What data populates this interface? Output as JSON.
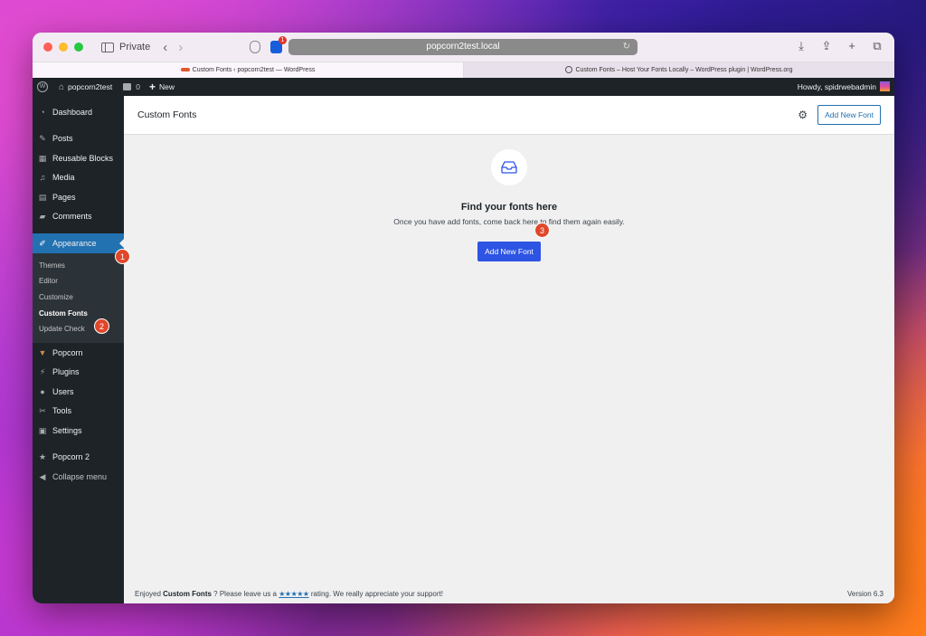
{
  "browser": {
    "private_label": "Private",
    "url": "popcorn2test.local",
    "tabs": [
      {
        "label": "Custom Fonts ‹ popcorn2test — WordPress"
      },
      {
        "label": "Custom Fonts – Host Your Fonts Locally – WordPress plugin | WordPress.org"
      }
    ],
    "extension_badge": "1"
  },
  "adminbar": {
    "site_name": "popcorn2test",
    "comment_count": "0",
    "new_label": "New",
    "howdy": "Howdy, spidrwebadmin"
  },
  "sidebar": {
    "items_top": [
      {
        "label": "Dashboard",
        "icon": "dashboard-icon"
      },
      {
        "label": "Posts",
        "icon": "pin-icon"
      },
      {
        "label": "Reusable Blocks",
        "icon": "blocks-icon"
      },
      {
        "label": "Media",
        "icon": "media-icon"
      },
      {
        "label": "Pages",
        "icon": "pages-icon"
      },
      {
        "label": "Comments",
        "icon": "comment-icon"
      }
    ],
    "appearance": {
      "label": "Appearance",
      "icon": "brush-icon"
    },
    "submenu": [
      {
        "label": "Themes"
      },
      {
        "label": "Editor"
      },
      {
        "label": "Customize"
      },
      {
        "label": "Custom Fonts"
      },
      {
        "label": "Update Check"
      }
    ],
    "items_bottom": [
      {
        "label": "Popcorn",
        "icon": "popcorn-icon"
      },
      {
        "label": "Plugins",
        "icon": "plug-icon"
      },
      {
        "label": "Users",
        "icon": "user-icon"
      },
      {
        "label": "Tools",
        "icon": "wrench-icon"
      },
      {
        "label": "Settings",
        "icon": "settings-icon"
      },
      {
        "label": "Popcorn 2",
        "icon": "star-icon"
      },
      {
        "label": "Collapse menu",
        "icon": "collapse-icon"
      }
    ],
    "badges": [
      "1",
      "2",
      "3"
    ]
  },
  "main": {
    "page_title": "Custom Fonts",
    "header_button": "Add New Font",
    "empty_title": "Find your fonts here",
    "empty_desc": "Once you have add fonts, come back here to find them again easily.",
    "primary_button": "Add New Font"
  },
  "footer": {
    "text_before": "Enjoyed",
    "plugin_name": "Custom Fonts",
    "text_middle": "? Please leave us a",
    "stars": "★★★★★",
    "text_after": "rating. We really appreciate your support!",
    "version": "Version 6.3"
  },
  "colors": {
    "wp_admin_dark": "#1d2327",
    "wp_blue": "#2271b1",
    "primary_button": "#2d54e3",
    "badge": "#e0472a"
  }
}
